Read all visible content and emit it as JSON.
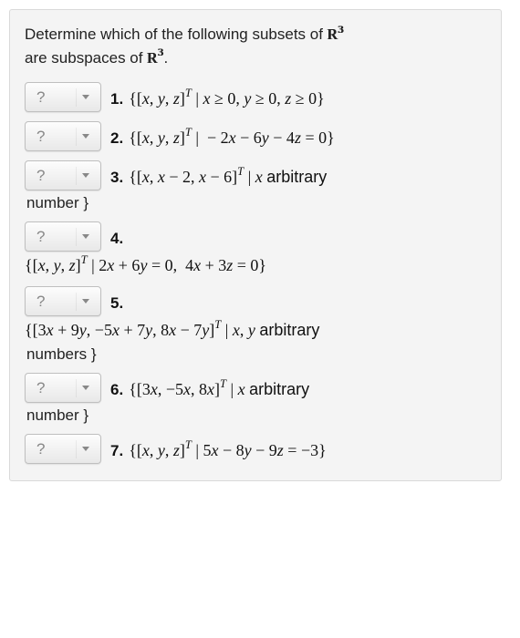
{
  "questionLine1": "Determine which of the following subsets of ",
  "r3_base": "R",
  "r3_exp": "3",
  "questionLine2": " are subspaces of ",
  "dropdownHint": "?",
  "items": [
    {
      "num": "1.",
      "expr": "{[x, y, z]ᵀ | x ≥ 0, y ≥ 0, z ≥ 0}",
      "continuation": ""
    },
    {
      "num": "2.",
      "expr": "{[x, y, z]ᵀ | − 2x − 6y − 4z = 0}",
      "continuation": ""
    },
    {
      "num": "3.",
      "expr": "{[x, x − 2, x − 6]ᵀ | x arbitrary",
      "continuation": "number }"
    },
    {
      "num": "4.",
      "expr": "",
      "wrapped": "{[x, y, z]ᵀ | 2x + 6y = 0,  4x + 3z = 0}",
      "continuation": ""
    },
    {
      "num": "5.",
      "expr": "",
      "wrapped": "{[3x + 9y, −5x + 7y, 8x − 7y]ᵀ | x, y arbitrary",
      "continuation": "numbers }"
    },
    {
      "num": "6.",
      "expr": "{[3x, −5x, 8x]ᵀ | x arbitrary",
      "continuation": "number }"
    },
    {
      "num": "7.",
      "expr": "{[x, y, z]ᵀ | 5x − 8y − 9z = −3}",
      "continuation": ""
    }
  ]
}
